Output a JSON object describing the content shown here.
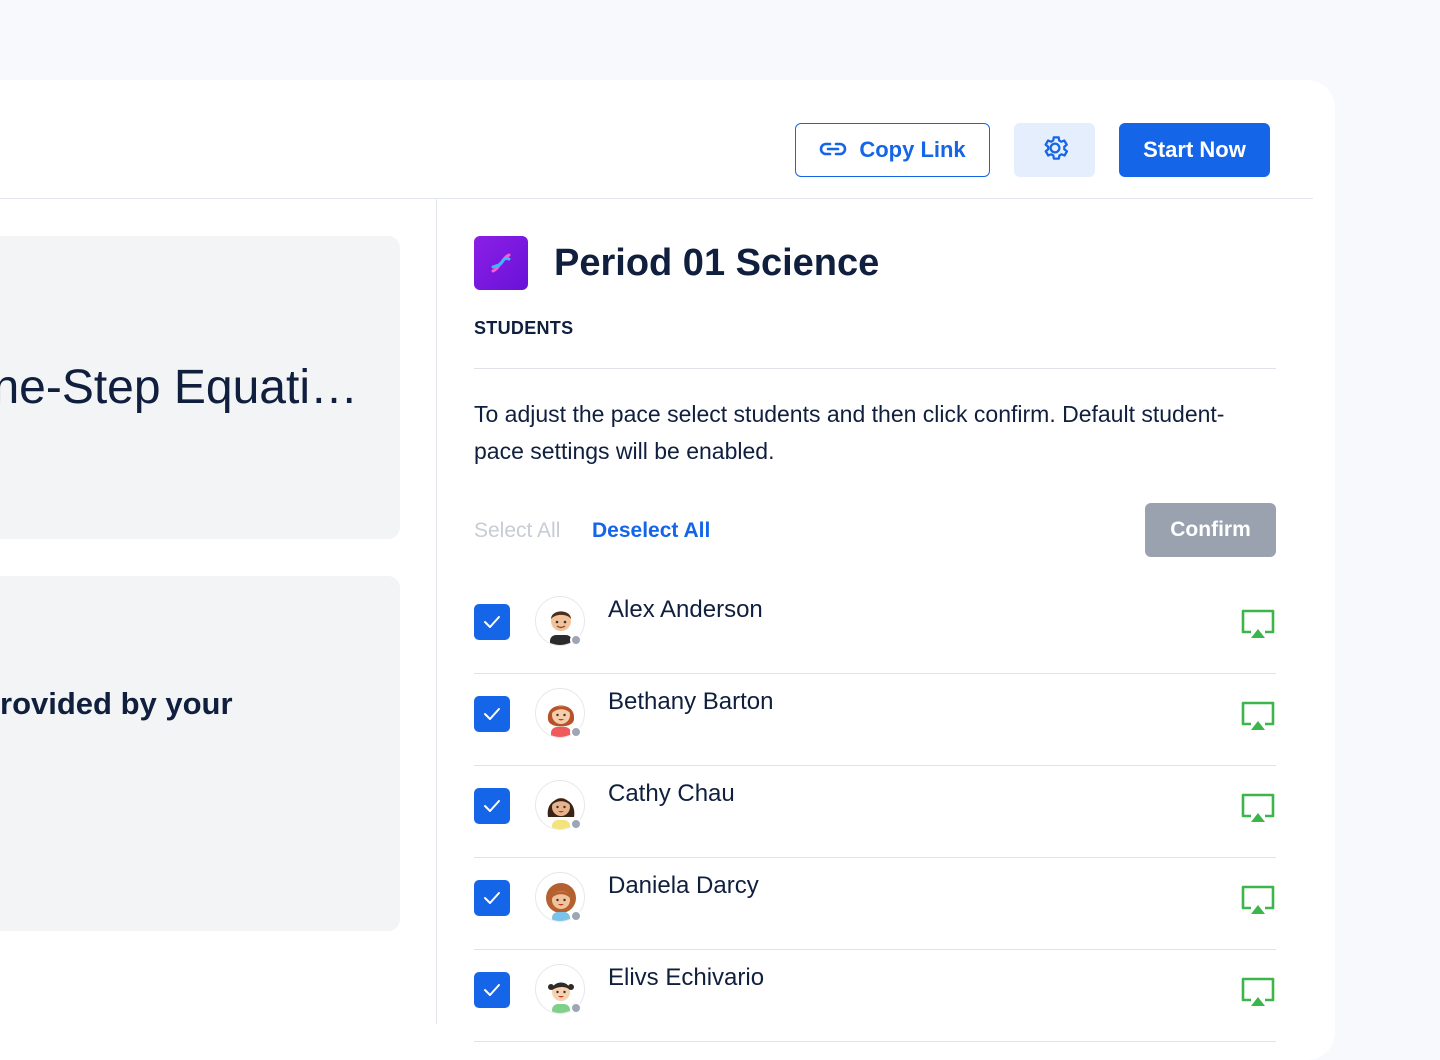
{
  "toolbar": {
    "copy_link_label": "Copy Link",
    "copy_link_icon": "link-icon",
    "settings_icon": "gear-icon",
    "start_label": "Start Now"
  },
  "left": {
    "lesson_title": "ne-Step Equati…",
    "subtitle": "rovided by your"
  },
  "class": {
    "icon": "class-dna-icon",
    "title": "Period 01 Science",
    "section_label": "STUDENTS",
    "instructions": "To adjust the pace select students and then click confirm. Default student-pace settings will be enabled.",
    "select_all": "Select All",
    "deselect_all": "Deselect All",
    "confirm_label": "Confirm"
  },
  "students": [
    {
      "name": "Alex Anderson",
      "checked": true,
      "avatar": "avatar-boy-icon",
      "status": "offline"
    },
    {
      "name": "Bethany Barton",
      "checked": true,
      "avatar": "avatar-girl-red-hair-icon",
      "status": "offline"
    },
    {
      "name": "Cathy Chau",
      "checked": true,
      "avatar": "avatar-girl-dark-hair-icon",
      "status": "offline"
    },
    {
      "name": "Daniela Darcy",
      "checked": true,
      "avatar": "avatar-girl-curly-hair-icon",
      "status": "offline"
    },
    {
      "name": "Elivs Echivario",
      "checked": true,
      "avatar": "avatar-child-icon",
      "status": "offline"
    }
  ],
  "colors": {
    "primary": "#1565e8",
    "confirm_disabled": "#9aa2af",
    "screen_icon": "#3cb54a",
    "class_icon": "#7a18df"
  }
}
